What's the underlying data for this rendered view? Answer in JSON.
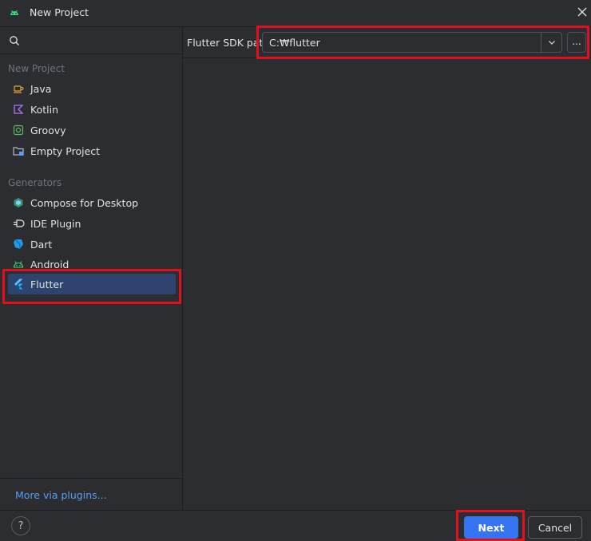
{
  "window": {
    "title": "New Project",
    "icon": "android-icon"
  },
  "search": {
    "icon": "search-icon"
  },
  "sidebar": {
    "sections": [
      {
        "label": "New Project",
        "items": [
          {
            "label": "Java",
            "icon": "java-icon"
          },
          {
            "label": "Kotlin",
            "icon": "kotlin-icon"
          },
          {
            "label": "Groovy",
            "icon": "groovy-icon"
          },
          {
            "label": "Empty Project",
            "icon": "folder-icon"
          }
        ]
      },
      {
        "label": "Generators",
        "items": [
          {
            "label": "Compose for Desktop",
            "icon": "compose-icon"
          },
          {
            "label": "IDE Plugin",
            "icon": "plugin-icon"
          },
          {
            "label": "Dart",
            "icon": "dart-icon"
          },
          {
            "label": "Android",
            "icon": "android-icon"
          },
          {
            "label": "Flutter",
            "icon": "flutter-icon",
            "selected": true
          }
        ]
      }
    ],
    "more_link": "More via plugins..."
  },
  "main": {
    "sdk_label": "Flutter SDK path:",
    "sdk_value": "C:₩flutter",
    "browse_label": "..."
  },
  "footer": {
    "help_label": "?",
    "next_label": "Next",
    "cancel_label": "Cancel"
  },
  "colors": {
    "background": "#2b2d30",
    "accent": "#3574f0",
    "selection": "#2e436e",
    "highlight": "#e0101e",
    "link": "#589df6"
  }
}
